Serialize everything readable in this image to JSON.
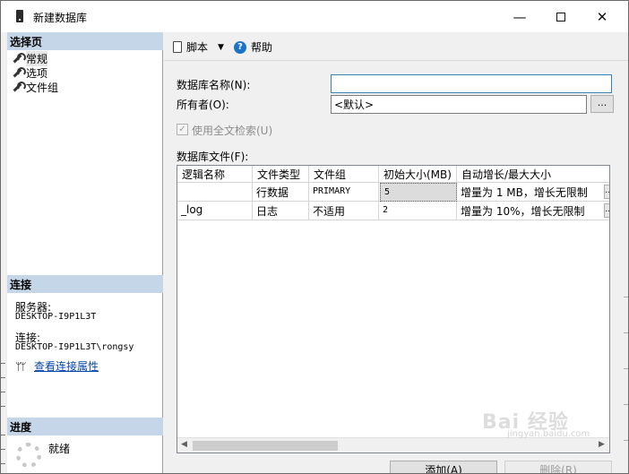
{
  "window": {
    "title": "新建数据库",
    "minimize_glyph": "—",
    "close_glyph": "✕"
  },
  "sidebar": {
    "select_page_header": "选择页",
    "pages": [
      {
        "label": "常规"
      },
      {
        "label": "选项"
      },
      {
        "label": "文件组"
      }
    ],
    "connection_header": "连接",
    "server_label": "服务器:",
    "server_value": "DESKTOP-I9P1L3T",
    "connection_label": "连接:",
    "connection_value": "DESKTOP-I9P1L3T\\rongsy",
    "view_props_link": "查看连接属性",
    "progress_header": "进度",
    "progress_status": "就绪"
  },
  "toolbar": {
    "script_label": "脚本",
    "help_label": "帮助"
  },
  "form": {
    "db_name_label": "数据库名称(N):",
    "db_name_value": "",
    "owner_label": "所有者(O):",
    "owner_value": "<默认>",
    "browse_label": "...",
    "fulltext_label": "使用全文检索(U)",
    "fulltext_checked": true,
    "files_label": "数据库文件(F):"
  },
  "grid": {
    "columns": [
      "逻辑名称",
      "文件类型",
      "文件组",
      "初始大小(MB)",
      "自动增长/最大大小"
    ],
    "rows": [
      {
        "logical_name": "",
        "file_type": "行数据",
        "filegroup": "PRIMARY",
        "initial_size": "5",
        "autogrowth": "增量为 1 MB，增长无限制"
      },
      {
        "logical_name": "_log",
        "file_type": "日志",
        "filegroup": "不适用",
        "initial_size": "2",
        "autogrowth": "增量为 10%，增长无限制"
      }
    ],
    "row_button_label": "..."
  },
  "buttons": {
    "add_label": "添加(A)",
    "remove_label": "删除(R)"
  },
  "watermark": {
    "text": "Bai 经验",
    "sub": "jingyan.baidu.com"
  },
  "colors": {
    "section_header_bg": "#c5d6e8",
    "link": "#0645ad",
    "help_icon": "#1a73c8"
  }
}
